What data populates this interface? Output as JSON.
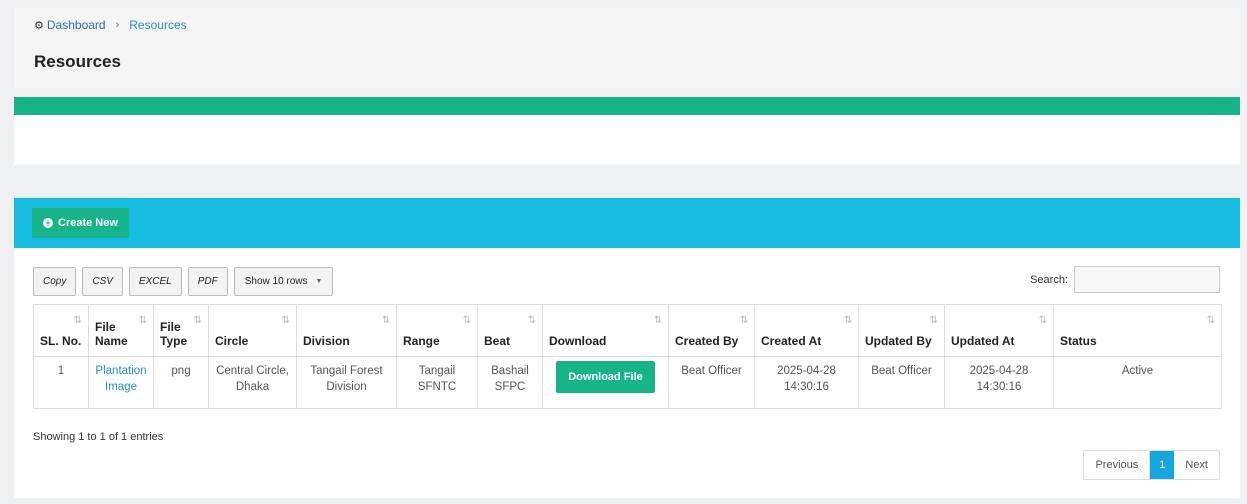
{
  "breadcrumb": {
    "home": "Dashboard",
    "current": "Resources"
  },
  "page_title": "Resources",
  "panel": {
    "create_label": "Create New"
  },
  "toolbar": {
    "copy": "Copy",
    "csv": "CSV",
    "excel": "EXCEL",
    "pdf": "PDF",
    "show_rows": "Show 10 rows"
  },
  "search": {
    "label": "Search:",
    "value": ""
  },
  "table": {
    "headers": [
      "SL. No.",
      "File Name",
      "File Type",
      "Circle",
      "Division",
      "Range",
      "Beat",
      "Download",
      "Created By",
      "Created At",
      "Updated By",
      "Updated At",
      "Status"
    ],
    "rows": [
      {
        "sl": "1",
        "file_name": "Plantation Image",
        "file_type": "png",
        "circle": "Central Circle, Dhaka",
        "division": "Tangail Forest Division",
        "range": "Tangail SFNTC",
        "beat": "Bashail SFPC",
        "download": "Download File",
        "created_by": "Beat Officer",
        "created_at": "2025-04-28 14:30:16",
        "updated_by": "Beat Officer",
        "updated_at": "2025-04-28 14:30:16",
        "status": "Active"
      }
    ]
  },
  "info": "Showing 1 to 1 of 1 entries",
  "pager": {
    "previous": "Previous",
    "page": "1",
    "next": "Next"
  },
  "colors": {
    "green": "#17b48b",
    "cyan": "#17bbe0",
    "link": "#2a8ebf"
  }
}
